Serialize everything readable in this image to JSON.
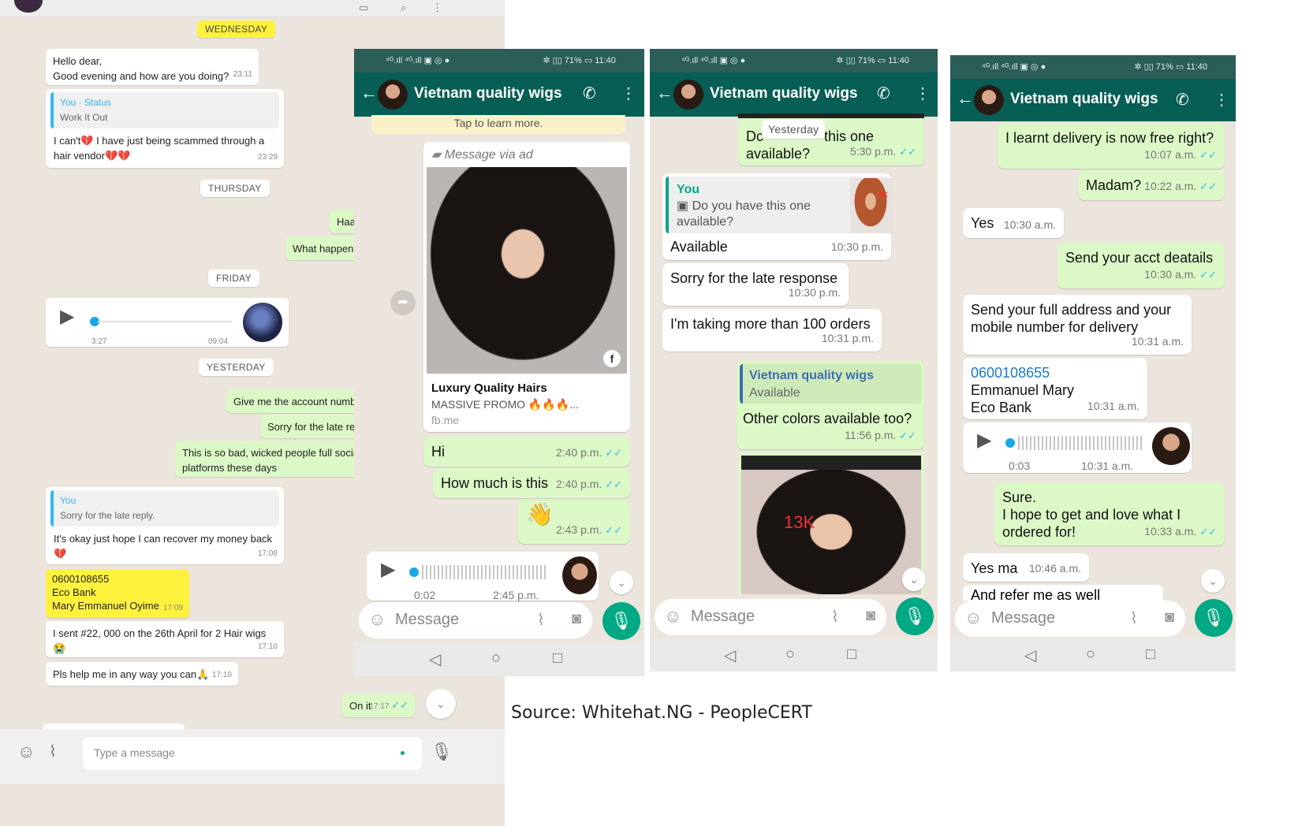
{
  "panel1": {
    "dates": [
      "WEDNESDAY",
      "THURSDAY",
      "FRIDAY",
      "YESTERDAY"
    ],
    "m1": {
      "text1": "Hello dear,",
      "text2": "Good evening and how are you doing?",
      "time": "23:11"
    },
    "m2": {
      "qname": "You · Status",
      "qtext": "Work It Out",
      "text1": "I can't",
      "text2": " I have just being scammed through a",
      "text3": "hair vendor",
      "time": "23:29"
    },
    "m3": {
      "text": "Haa"
    },
    "m4": {
      "text": "What happen"
    },
    "m5": {
      "start": "3:27",
      "time": "09:04"
    },
    "m6": {
      "text": "Give me the account numb"
    },
    "m7": {
      "text": "Sorry for the late re"
    },
    "m8": {
      "text1": "This is so bad, wicked people full socia",
      "text2": "platforms these days"
    },
    "m9": {
      "qname": "You",
      "qtext": "Sorry for the late reply.",
      "text": "It's okay just hope I can recover my money back",
      "time": "17:08"
    },
    "m10": {
      "l1": "0600108655",
      "l2": "Eco Bank",
      "l3": "Mary Emmanuel Oyime",
      "time": "17:09"
    },
    "m11": {
      "text": "I sent #22, 000 on the 26th April for 2 Hair wigs",
      "time": "17:10"
    },
    "m12": {
      "text": "Pls help me in any way you can",
      "time": "17:10"
    },
    "m13": {
      "text": "On it",
      "time": "17:17"
    },
    "input_placeholder": "Type a message"
  },
  "phone_common": {
    "status_left": "⁴ᴳ.ıll ⁴ᴳ.ıll ▣ ◎ ●",
    "status_right": "✲ ▯▯ 71% ▭ 11:40",
    "title": "Vietnam quality wigs",
    "message_placeholder": "Message"
  },
  "phone2": {
    "tap_text": "Tap to learn more.",
    "ad_label": "Message via ad",
    "ad_title": "Luxury Quality Hairs",
    "ad_sub": "MASSIVE PROMO 🔥🔥🔥...",
    "ad_link": "fb.me",
    "msgs": [
      {
        "text": "Hi",
        "time": "2:40 p.m."
      },
      {
        "text": "How much is this",
        "time": "2:40 p.m."
      },
      {
        "text": "👋",
        "time": "2:43 p.m."
      }
    ],
    "voice": {
      "start": "0:02",
      "time": "2:45 p.m."
    }
  },
  "phone3": {
    "top_text1": "Dc",
    "top_text2": "this one",
    "top_text3": "available?",
    "top_time": "5:30 p.m.",
    "yesterday": "Yesterday",
    "reply": {
      "qname": "You",
      "qtext1": "Do you have this one",
      "qtext2": "available?",
      "badge": "9K",
      "text": "Available",
      "time": "10:30 p.m."
    },
    "msgs": [
      {
        "text": "Sorry for the late response",
        "time": "10:30 p.m."
      },
      {
        "text": "I'm taking more than 100 orders",
        "time": "10:31 p.m."
      }
    ],
    "out_reply": {
      "qname": "Vietnam quality wigs",
      "qtext": "Available",
      "text": "Other colors available too?",
      "time": "11:56 p.m."
    },
    "img_badge": "13K"
  },
  "phone4": {
    "msgs_out1": {
      "text": "I learnt delivery is now free right?",
      "time": "10:07 a.m."
    },
    "msgs_out2": {
      "text": "Madam?",
      "time": "10:22 a.m."
    },
    "in1": {
      "text": "Yes",
      "time": "10:30 a.m."
    },
    "out3": {
      "text": "Send your acct deatails",
      "time": "10:30 a.m."
    },
    "in2": {
      "text1": "Send your full address and your",
      "text2": "mobile number for delivery",
      "time": "10:31 a.m."
    },
    "in3": {
      "l1": "0600108655",
      "l2": "Emmanuel Mary",
      "l3": "Eco Bank",
      "time": "10:31 a.m."
    },
    "voice": {
      "start": "0:03",
      "time": "10:31 a.m."
    },
    "out4": {
      "l1": "Sure.",
      "l2": "I hope to get and love what I",
      "l3": "ordered for!",
      "time": "10:33 a.m."
    },
    "in4": {
      "text": "Yes ma",
      "time": "10:46 a.m."
    },
    "in5": {
      "text": "And refer me as well"
    }
  },
  "caption": "Source: Whitehat.NG - PeopleCERT"
}
